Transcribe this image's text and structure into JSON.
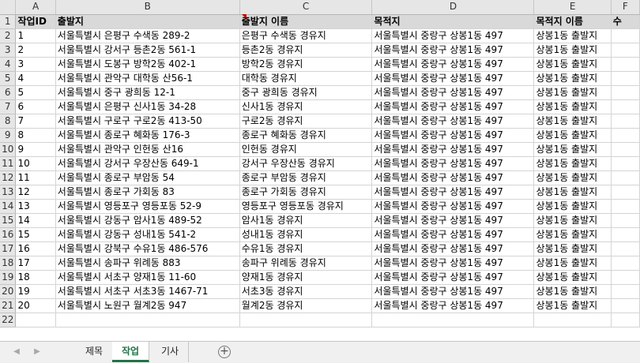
{
  "sheet": {
    "columns": [
      "A",
      "B",
      "C",
      "D",
      "E",
      "F"
    ],
    "header_row": [
      "작업ID",
      "출발지",
      "출발지 이름",
      "목적지",
      "목적지 이름",
      "수"
    ],
    "rows": [
      [
        1,
        "서울특별시 은평구 수색동 289-2",
        "은평구 수색동 경유지",
        "서울특별시 중랑구 상봉1동 497",
        "상봉1동 출발지"
      ],
      [
        2,
        "서울특별시 강서구 등촌2동 561-1",
        "등촌2동 경유지",
        "서울특별시 중랑구 상봉1동 497",
        "상봉1동 출발지"
      ],
      [
        3,
        "서울특별시 도봉구 방학2동 402-1",
        "방학2동 경유지",
        "서울특별시 중랑구 상봉1동 497",
        "상봉1동 출발지"
      ],
      [
        4,
        "서울특별시 관악구 대학동 산56-1",
        "대학동 경유지",
        "서울특별시 중랑구 상봉1동 497",
        "상봉1동 출발지"
      ],
      [
        5,
        "서울특별시 중구 광희동 12-1",
        "중구 광희동 경유지",
        "서울특별시 중랑구 상봉1동 497",
        "상봉1동 출발지"
      ],
      [
        6,
        "서울특별시 은평구 신사1동 34-28",
        "신사1동 경유지",
        "서울특별시 중랑구 상봉1동 497",
        "상봉1동 출발지"
      ],
      [
        7,
        "서울특별시 구로구 구로2동 413-50",
        "구로2동 경유지",
        "서울특별시 중랑구 상봉1동 497",
        "상봉1동 출발지"
      ],
      [
        8,
        "서울특별시 종로구 혜화동 176-3",
        "종로구 혜화동 경유지",
        "서울특별시 중랑구 상봉1동 497",
        "상봉1동 출발지"
      ],
      [
        9,
        "서울특별시 관악구 인헌동 산16",
        "인헌동 경유지",
        "서울특별시 중랑구 상봉1동 497",
        "상봉1동 출발지"
      ],
      [
        10,
        "서울특별시 강서구 우장산동 649-1",
        "강서구 우장산동 경유지",
        "서울특별시 중랑구 상봉1동 497",
        "상봉1동 출발지"
      ],
      [
        11,
        "서울특별시 종로구 부암동 54",
        "종로구 부암동 경유지",
        "서울특별시 중랑구 상봉1동 497",
        "상봉1동 출발지"
      ],
      [
        12,
        "서울특별시 종로구 가회동 83",
        "종로구 가회동 경유지",
        "서울특별시 중랑구 상봉1동 497",
        "상봉1동 출발지"
      ],
      [
        13,
        "서울특별시 영등포구 영등포동 52-9",
        "영등포구 영등포동 경유지",
        "서울특별시 중랑구 상봉1동 497",
        "상봉1동 출발지"
      ],
      [
        14,
        "서울특별시 강동구 암사1동 489-52",
        "암사1동 경유지",
        "서울특별시 중랑구 상봉1동 497",
        "상봉1동 출발지"
      ],
      [
        15,
        "서울특별시 강동구 성내1동 541-2",
        "성내1동 경유지",
        "서울특별시 중랑구 상봉1동 497",
        "상봉1동 출발지"
      ],
      [
        16,
        "서울특별시 강북구 수유1동 486-576",
        "수유1동 경유지",
        "서울특별시 중랑구 상봉1동 497",
        "상봉1동 출발지"
      ],
      [
        17,
        "서울특별시 송파구 위례동 883",
        "송파구 위례동 경유지",
        "서울특별시 중랑구 상봉1동 497",
        "상봉1동 출발지"
      ],
      [
        18,
        "서울특별시 서초구 양재1동 11-60",
        "양재1동 경유지",
        "서울특별시 중랑구 상봉1동 497",
        "상봉1동 출발지"
      ],
      [
        19,
        "서울특별시 서초구 서초3동 1467-71",
        "서초3동 경유지",
        "서울특별시 중랑구 상봉1동 497",
        "상봉1동 출발지"
      ],
      [
        20,
        "서울특별시 노원구 월계2동 947",
        "월계2동 경유지",
        "서울특별시 중랑구 상봉1동 497",
        "상봉1동 출발지"
      ]
    ],
    "row_numbers": [
      "1",
      "2",
      "3",
      "4",
      "5",
      "6",
      "7",
      "8",
      "9",
      "10",
      "11",
      "12",
      "13",
      "14",
      "15",
      "16",
      "17",
      "18",
      "19",
      "20",
      "21",
      "22"
    ]
  },
  "tabs": [
    {
      "label": "제목",
      "active": false
    },
    {
      "label": "작업",
      "active": true
    },
    {
      "label": "기사",
      "active": false
    }
  ],
  "icons": {
    "prev": "triangle-left-icon",
    "next": "triangle-right-icon",
    "add": "plus-circle-icon"
  },
  "colors": {
    "accent": "#217346",
    "comment": "#c00000"
  },
  "add_sheet_symbol": "+"
}
